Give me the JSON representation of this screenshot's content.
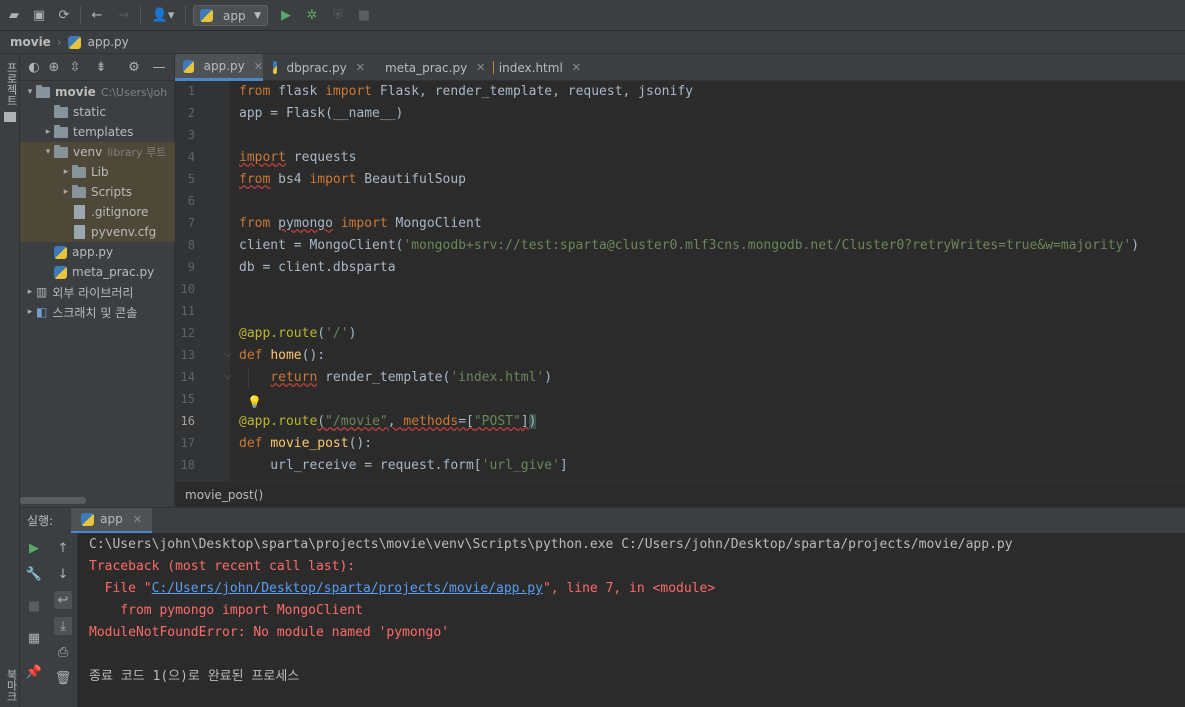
{
  "toolbar": {
    "run_config": "app",
    "icons": [
      "open-folder-icon",
      "save-icon",
      "sync-icon",
      "back-icon",
      "forward-icon",
      "user-icon",
      "run-icon",
      "debug-icon",
      "coverage-icon",
      "stop-icon"
    ]
  },
  "breadcrumb": {
    "project": "movie",
    "file": "app.py"
  },
  "side_strips": {
    "project_label": "프로젝트",
    "bookmarks_label": "북마크"
  },
  "project_tree": [
    {
      "label": "movie",
      "hint": "C:\\Users\\joh",
      "type": "folder",
      "indent": 0,
      "arrow": "▾",
      "bold": true
    },
    {
      "label": "static",
      "type": "folder",
      "indent": 1,
      "arrow": ""
    },
    {
      "label": "templates",
      "type": "folder",
      "indent": 1,
      "arrow": "▸"
    },
    {
      "label": "venv",
      "hint": "library 루트",
      "type": "folder",
      "indent": 1,
      "arrow": "▾",
      "venv": true
    },
    {
      "label": "Lib",
      "type": "folder",
      "indent": 2,
      "arrow": "▸",
      "venv": true
    },
    {
      "label": "Scripts",
      "type": "folder",
      "indent": 2,
      "arrow": "▸",
      "venv": true
    },
    {
      "label": ".gitignore",
      "type": "text",
      "indent": 2,
      "arrow": "",
      "venv": true
    },
    {
      "label": "pyvenv.cfg",
      "type": "text",
      "indent": 2,
      "arrow": "",
      "venv": true
    },
    {
      "label": "app.py",
      "type": "py",
      "indent": 1,
      "arrow": ""
    },
    {
      "label": "meta_prac.py",
      "type": "py",
      "indent": 1,
      "arrow": ""
    },
    {
      "label": "외부 라이브러리",
      "type": "lib",
      "indent": 0,
      "arrow": "▸"
    },
    {
      "label": "스크래치 및 콘솔",
      "type": "scratch",
      "indent": 0,
      "arrow": "▸"
    }
  ],
  "editor_tabs": [
    {
      "label": "app.py",
      "type": "py",
      "active": true
    },
    {
      "label": "dbprac.py",
      "type": "py",
      "active": false
    },
    {
      "label": "meta_prac.py",
      "type": "py",
      "active": false
    },
    {
      "label": "index.html",
      "type": "html",
      "active": false
    }
  ],
  "code": {
    "current_line": 16,
    "lines": [
      [
        [
          "kw",
          "from"
        ],
        [
          "p",
          " flask "
        ],
        [
          "kw",
          "import"
        ],
        [
          "p",
          " Flask, render_template, request, jsonify"
        ]
      ],
      [
        [
          "p",
          "app = Flask(__name__)"
        ]
      ],
      [],
      [
        [
          "kws",
          "import"
        ],
        [
          "p",
          " requests"
        ]
      ],
      [
        [
          "kws",
          "from"
        ],
        [
          "p",
          " bs4 "
        ],
        [
          "kw",
          "import"
        ],
        [
          "p",
          " BeautifulSoup"
        ]
      ],
      [],
      [
        [
          "kw",
          "from"
        ],
        [
          "p",
          " "
        ],
        [
          "ps",
          "pymongo"
        ],
        [
          "p",
          " "
        ],
        [
          "kw",
          "import"
        ],
        [
          "p",
          " MongoClient"
        ]
      ],
      [
        [
          "p",
          "client = MongoClient("
        ],
        [
          "str",
          "'mongodb+srv://test:sparta@cluster0.mlf3cns.mongodb.net/Cluster0?retryWrites=true&w=majority'"
        ],
        [
          "p",
          ")"
        ]
      ],
      [
        [
          "p",
          "db = client.dbsparta"
        ]
      ],
      [],
      [],
      [
        [
          "dec",
          "@app.route"
        ],
        [
          "p",
          "("
        ],
        [
          "str",
          "'/'"
        ],
        [
          "p",
          ")"
        ]
      ],
      [
        [
          "kw",
          "def"
        ],
        [
          "p",
          " "
        ],
        [
          "fn",
          "home"
        ],
        [
          "p",
          "():"
        ]
      ],
      [
        [
          "p",
          "    "
        ],
        [
          "kws",
          "return"
        ],
        [
          "p",
          " render_template("
        ],
        [
          "str",
          "'index.html'"
        ],
        [
          "p",
          ")"
        ]
      ],
      [],
      [
        [
          "dec",
          "@app.route"
        ],
        [
          "ps",
          "("
        ],
        [
          "strs",
          "\"/movie\""
        ],
        [
          "ps",
          ", "
        ],
        [
          "kws2",
          "methods"
        ],
        [
          "ps",
          "=["
        ],
        [
          "strs",
          "\"POST\""
        ],
        [
          "ps",
          "]"
        ],
        [
          "mbr",
          ")"
        ]
      ],
      [
        [
          "kw",
          "def"
        ],
        [
          "p",
          " "
        ],
        [
          "fn",
          "movie_post"
        ],
        [
          "p",
          "():"
        ]
      ],
      [
        [
          "p",
          "    url_receive = request.form["
        ],
        [
          "str",
          "'url_give'"
        ],
        [
          "p",
          "]"
        ]
      ]
    ]
  },
  "editor_breadcrumb": "movie_post()",
  "run_panel": {
    "label": "실행:",
    "tab": "app",
    "console": [
      [
        [
          "norm",
          "C:\\Users\\john\\Desktop\\sparta\\projects\\movie\\venv\\Scripts\\python.exe C:/Users/john/Desktop/sparta/projects/movie/app.py"
        ]
      ],
      [
        [
          "err",
          "Traceback (most recent call last):"
        ]
      ],
      [
        [
          "err",
          "  File \""
        ],
        [
          "link",
          "C:/Users/john/Desktop/sparta/projects/movie/app.py"
        ],
        [
          "err",
          "\", line 7, in <module>"
        ]
      ],
      [
        [
          "err",
          "    from pymongo import MongoClient"
        ]
      ],
      [
        [
          "err",
          "ModuleNotFoundError: No module named 'pymongo'"
        ]
      ],
      [],
      [
        [
          "norm",
          "종료 코드 1(으)로 완료된 프로세스"
        ]
      ]
    ]
  }
}
